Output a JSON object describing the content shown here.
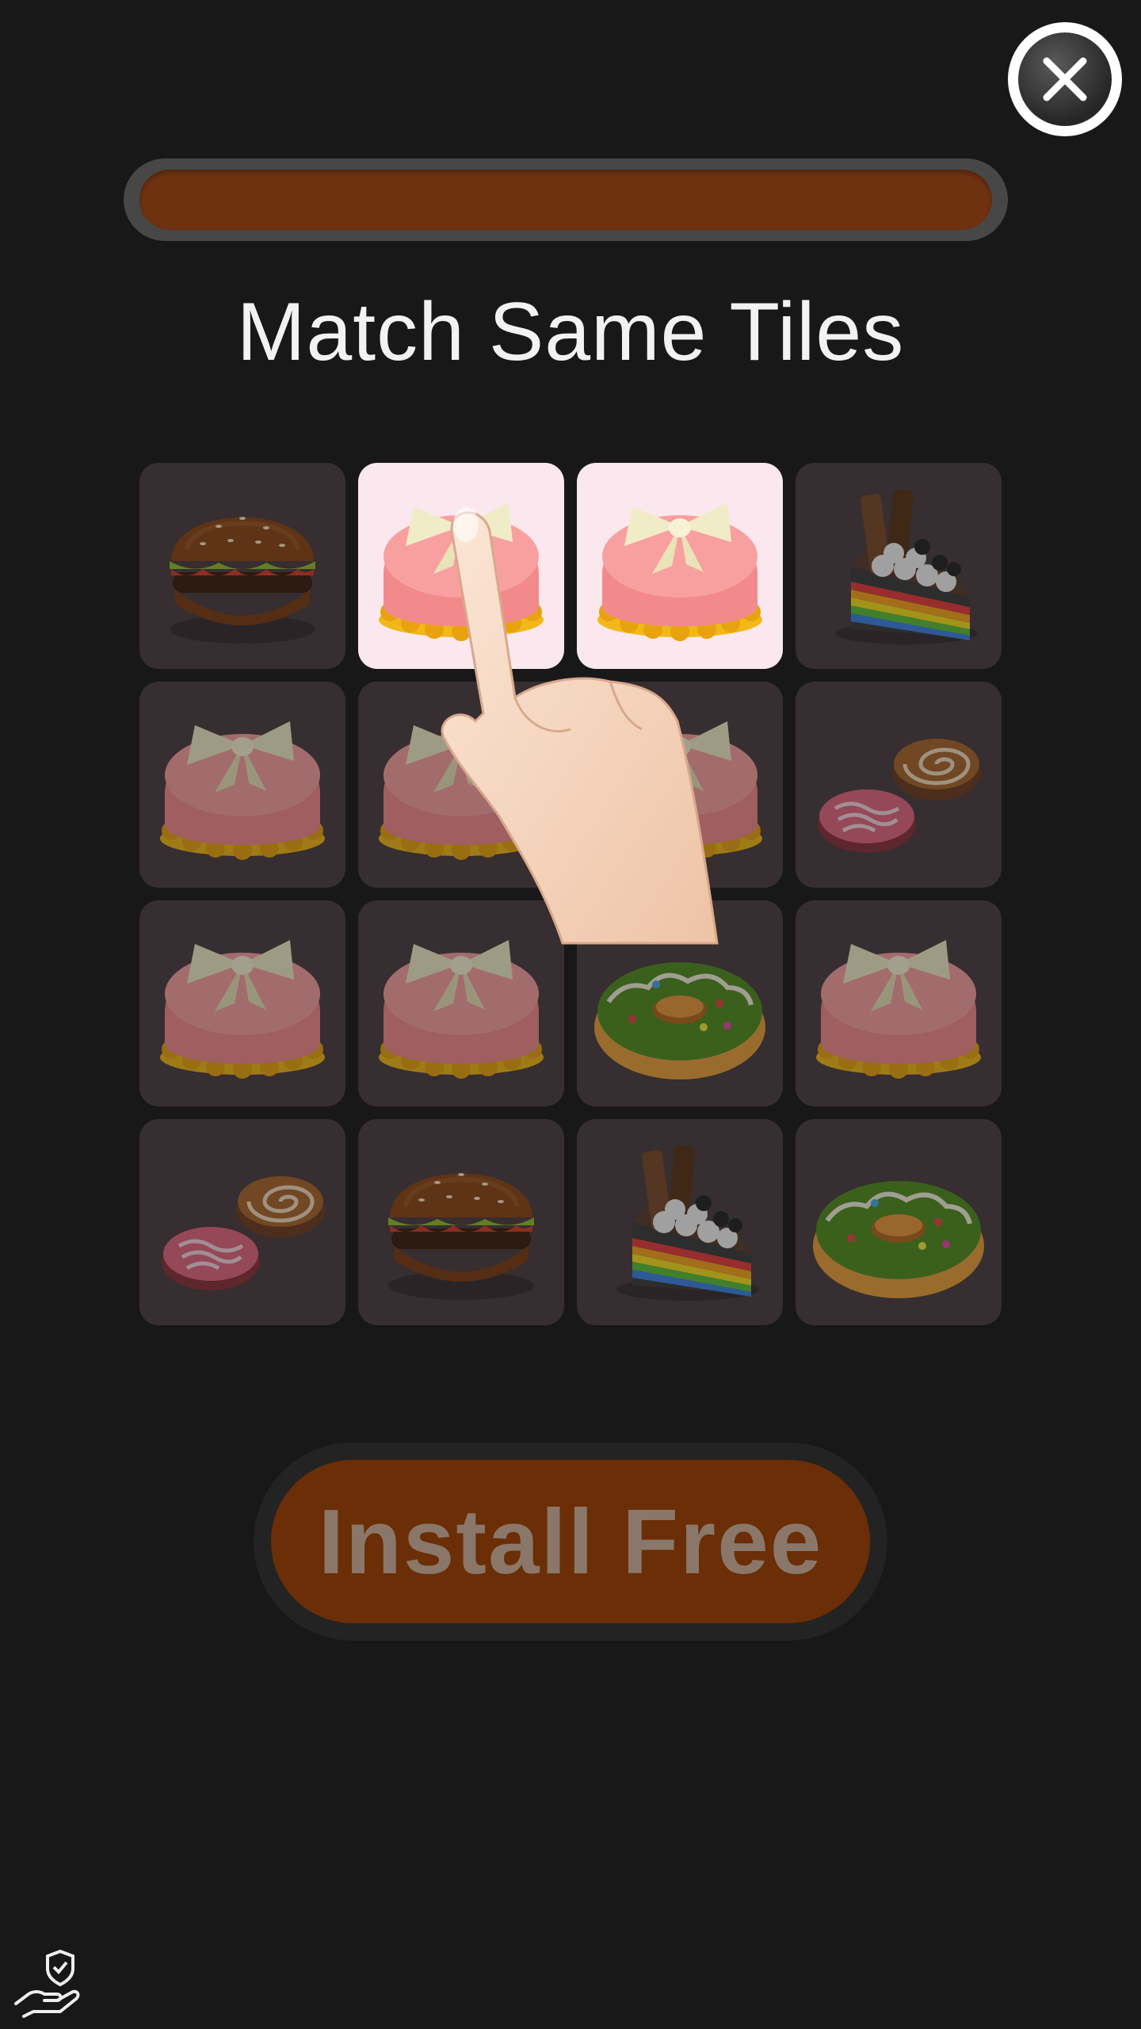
{
  "header": {
    "close_icon": "close-circle-icon",
    "progress": 1.0,
    "progress_color": "#6e3211"
  },
  "title": "Match Same Tiles",
  "board": {
    "rows": 4,
    "columns": 4,
    "tiles": [
      {
        "item": "burger",
        "selected": false
      },
      {
        "item": "macaron",
        "selected": true
      },
      {
        "item": "macaron",
        "selected": true
      },
      {
        "item": "rainbow-cake",
        "selected": false
      },
      {
        "item": "macaron",
        "selected": false
      },
      {
        "item": "macaron",
        "selected": false
      },
      {
        "item": "macaron",
        "selected": false
      },
      {
        "item": "cookies",
        "selected": false
      },
      {
        "item": "macaron",
        "selected": false
      },
      {
        "item": "macaron",
        "selected": false
      },
      {
        "item": "donut",
        "selected": false
      },
      {
        "item": "macaron",
        "selected": false
      },
      {
        "item": "cookies",
        "selected": false
      },
      {
        "item": "burger",
        "selected": false
      },
      {
        "item": "rainbow-cake",
        "selected": false
      },
      {
        "item": "donut",
        "selected": false
      }
    ],
    "hint": "pointing-hand-icon"
  },
  "cta": {
    "label": "Install Free",
    "color": "#6b2e06"
  },
  "footer": {
    "privacy_icon": "privacy-hand-shield-icon"
  }
}
